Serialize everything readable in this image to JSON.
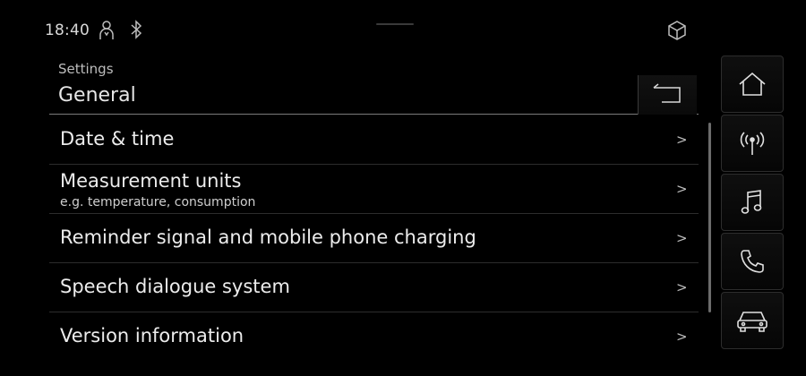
{
  "status_bar": {
    "time": "18:40",
    "icons": [
      "person-icon",
      "bluetooth-icon",
      "package-icon"
    ]
  },
  "header": {
    "breadcrumb": "Settings",
    "title": "General",
    "back_icon": "back-arrow-icon"
  },
  "menu": {
    "items": [
      {
        "title": "Date & time",
        "subtitle": "",
        "chevron": ">"
      },
      {
        "title": "Measurement units",
        "subtitle": "e.g. temperature, consumption",
        "chevron": ">"
      },
      {
        "title": "Reminder signal and mobile phone charging",
        "subtitle": "",
        "chevron": ">"
      },
      {
        "title": "Speech dialogue system",
        "subtitle": "",
        "chevron": ">"
      },
      {
        "title": "Version information",
        "subtitle": "",
        "chevron": ">"
      }
    ]
  },
  "side_nav": {
    "icons": [
      "home-icon",
      "radio-icon",
      "music-note-icon",
      "phone-icon",
      "car-icon"
    ]
  },
  "colors": {
    "background": "#000000",
    "text": "#ececec",
    "divider": "#2c2c2c"
  }
}
